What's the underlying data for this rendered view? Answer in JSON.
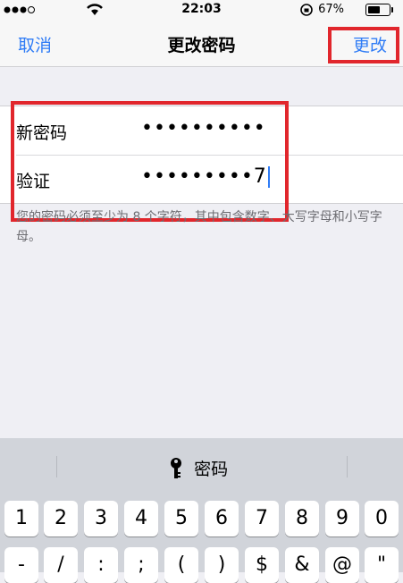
{
  "status_bar": {
    "time": "22:03",
    "battery_percent": "67%",
    "battery_level": 0.67
  },
  "nav": {
    "cancel_label": "取消",
    "title": "更改密码",
    "change_label": "更改"
  },
  "form": {
    "rows": [
      {
        "label": "新密码",
        "value": "••••••••••"
      },
      {
        "label": "验证",
        "value": "•••••••••7"
      }
    ],
    "hint": "您的密码必须至少为 8 个字符，其中包含数字、大写字母和小写字母。"
  },
  "keyboard": {
    "suggestion": "密码",
    "number_keys": [
      "1",
      "2",
      "3",
      "4",
      "5",
      "6",
      "7",
      "8",
      "9",
      "0"
    ],
    "partial_row_keys": [
      "-",
      "/",
      ":",
      ";",
      "(",
      ")",
      "$",
      "&",
      "@",
      "\""
    ]
  },
  "colors": {
    "accent": "#2f7cf6",
    "highlight": "#e1262c"
  }
}
